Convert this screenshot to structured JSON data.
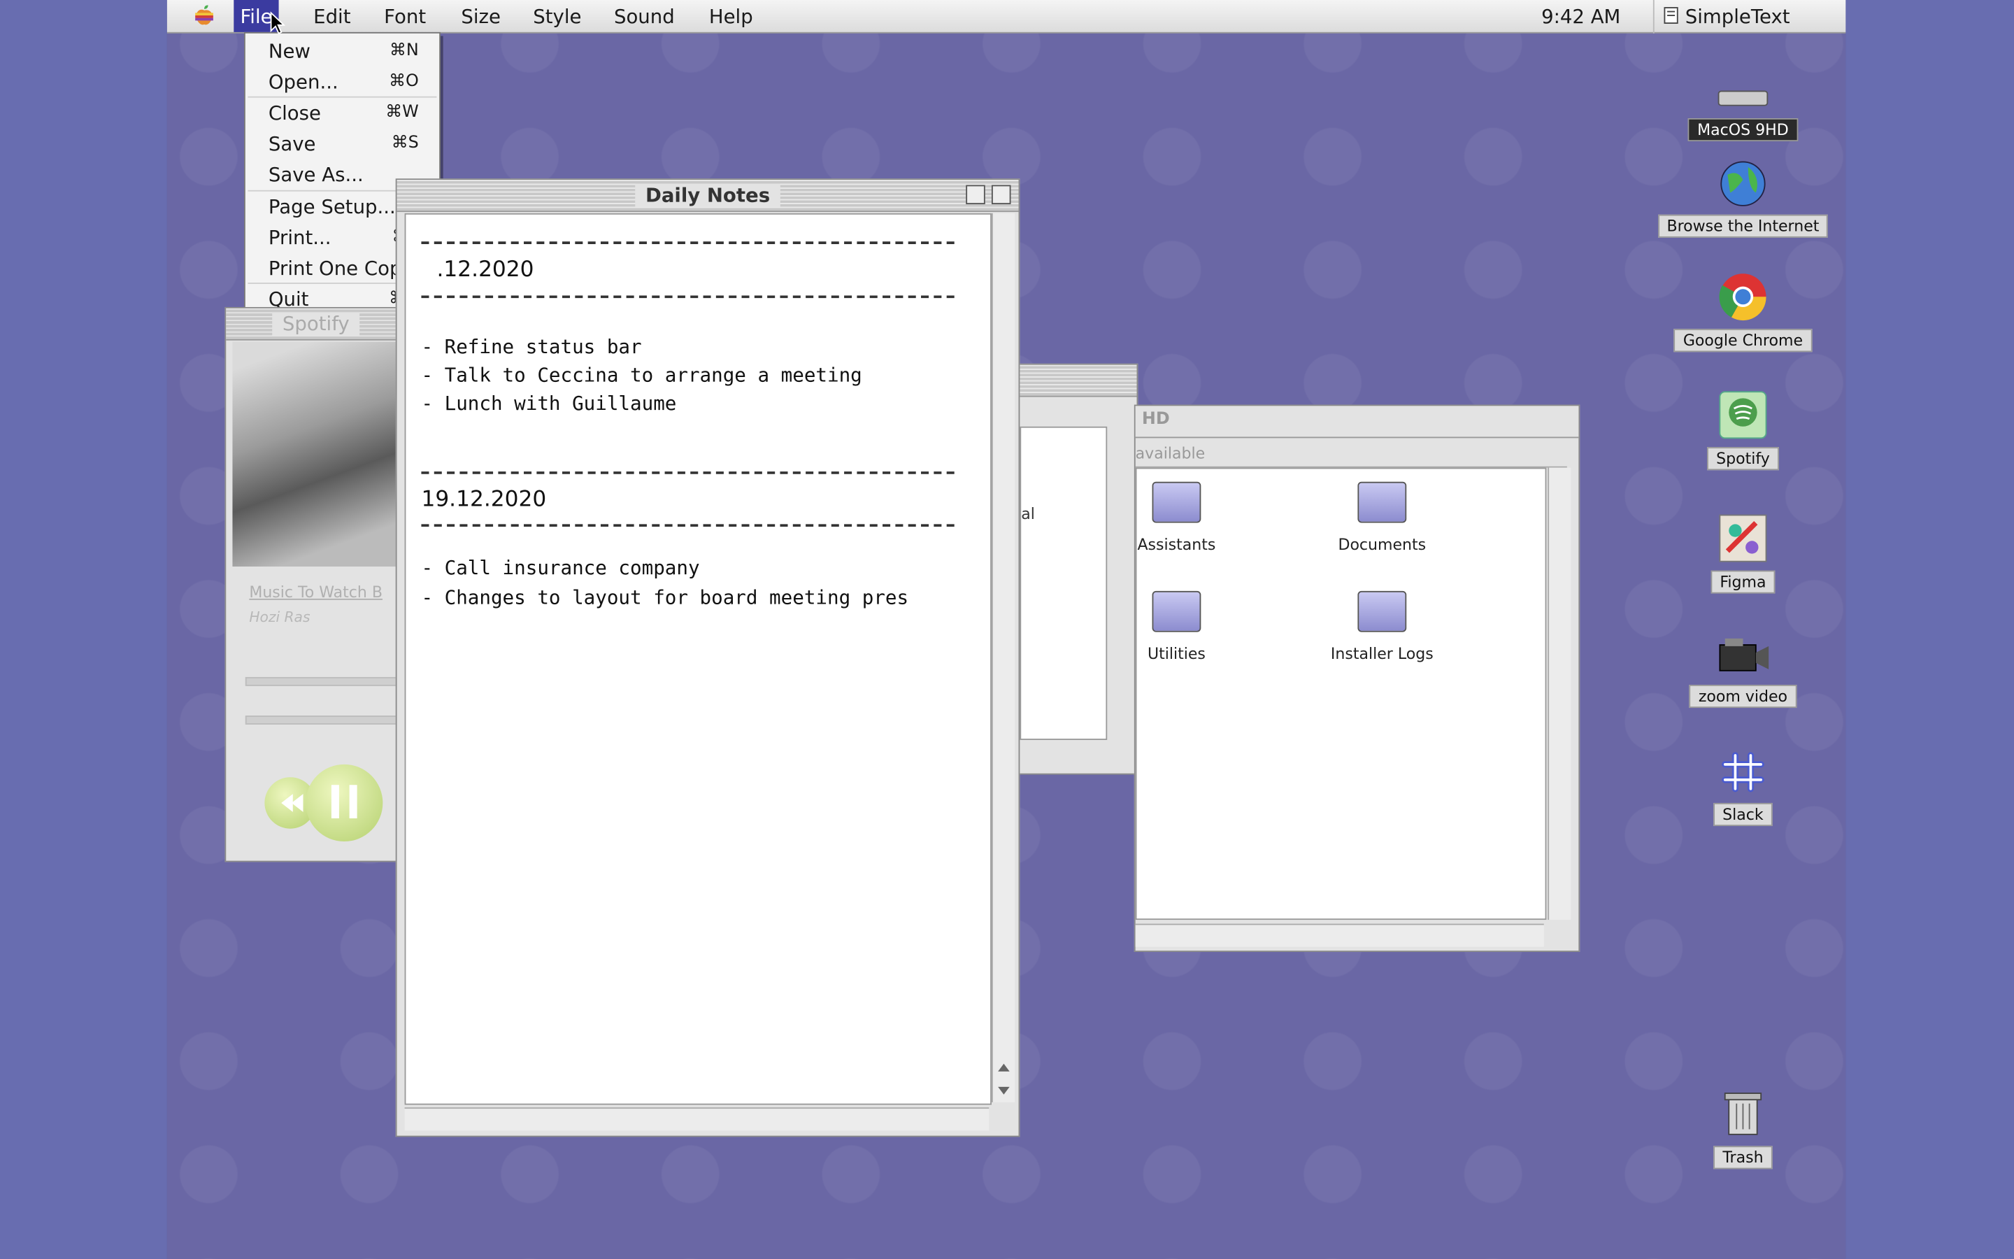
{
  "menubar": {
    "items": [
      "File",
      "Edit",
      "Font",
      "Size",
      "Style",
      "Sound",
      "Help"
    ],
    "active_item": "File",
    "clock": "9:42 AM",
    "app_name": "SimpleText"
  },
  "file_menu": {
    "items": [
      {
        "label": "New",
        "shortcut": "⌘N"
      },
      {
        "label": "Open...",
        "shortcut": "⌘O"
      },
      {
        "label": "Close",
        "shortcut": "⌘W"
      },
      {
        "label": "Save",
        "shortcut": "⌘S"
      },
      {
        "label": "Save As...",
        "shortcut": ""
      },
      {
        "label": "Page Setup...",
        "shortcut": ""
      },
      {
        "label": "Print...",
        "shortcut": "⌘P"
      },
      {
        "label": "Print One Copy",
        "shortcut": ""
      },
      {
        "label": "Quit",
        "shortcut": "⌘Q"
      }
    ]
  },
  "notes_window": {
    "title": "Daily Notes",
    "date1": ".12.2020",
    "entries1": [
      "- Refine status bar",
      "- Talk to Ceccina to arrange a meeting",
      "- Lunch with Guillaume"
    ],
    "date2": "19.12.2020",
    "entries2": [
      "- Call insurance company",
      "- Changes to layout for board meeting pres"
    ]
  },
  "spotify_window": {
    "title": "Spotify",
    "song": "Music To Watch B",
    "artist": "Hozi Ras"
  },
  "finder_window": {
    "title": "HD",
    "info": "available",
    "partial_label": "al",
    "items": [
      "Assistants",
      "Documents",
      "Utilities",
      "Installer Logs"
    ]
  },
  "desktop_icons": [
    {
      "label": "MacOS 9HD",
      "icon": "hard-drive-icon"
    },
    {
      "label": "Browse the Internet",
      "icon": "globe-icon"
    },
    {
      "label": "Google Chrome",
      "icon": "chrome-icon"
    },
    {
      "label": "Spotify",
      "icon": "spotify-icon"
    },
    {
      "label": "Figma",
      "icon": "figma-icon"
    },
    {
      "label": "zoom video",
      "icon": "camera-icon"
    },
    {
      "label": "Slack",
      "icon": "slack-icon"
    },
    {
      "label": "Trash",
      "icon": "trash-icon"
    }
  ],
  "colors": {
    "desktop": "#6a67a5",
    "menu_highlight": "#3b3ba0"
  }
}
